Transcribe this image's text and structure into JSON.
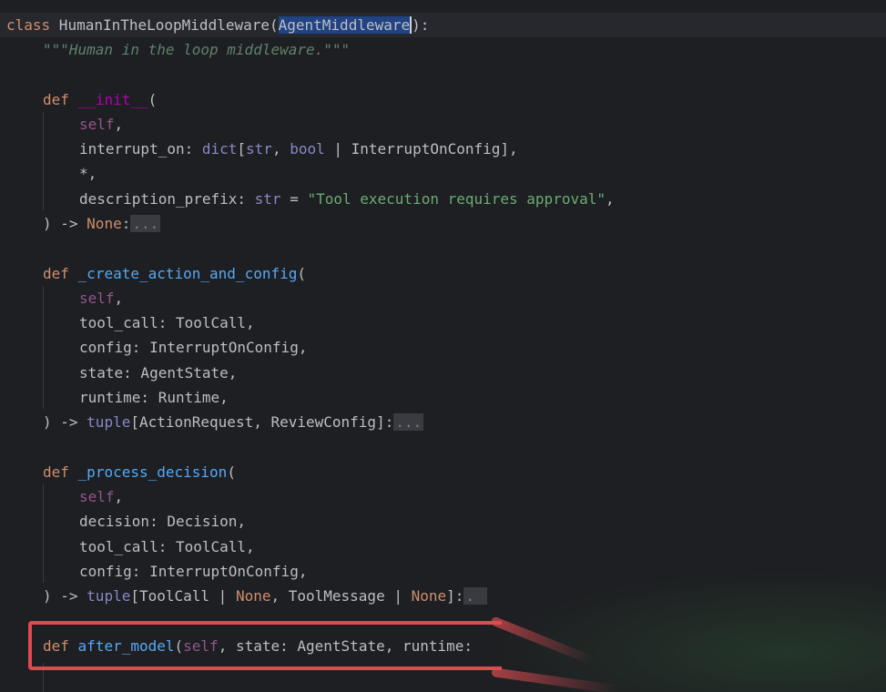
{
  "colors": {
    "background": "#1e1f22",
    "keyword": "#cf8e6d",
    "function_name": "#56a8f5",
    "self": "#94558d",
    "builtin": "#8888c6",
    "string": "#6aab73",
    "docstring": "#5f826b",
    "selection": "#214283",
    "annotation_box": "#e0494f"
  },
  "code": {
    "class_line": {
      "kw": "class",
      "name": " HumanInTheLoopMiddleware(",
      "base": "AgentMiddleware",
      "end": "):"
    },
    "docstring": "\"\"\"Human in the loop middleware.\"\"\"",
    "init": {
      "kw": "def",
      "name": "__init__",
      "open": "(",
      "self": "self",
      "comma": ",",
      "p1_name": "interrupt_on: ",
      "p1_dict": "dict",
      "p1_b1": "[",
      "p1_str": "str",
      "p1_sep": ", ",
      "p1_bool": "bool",
      "p1_rest": " | InterruptOnConfig],",
      "star": "*,",
      "p2_name": "description_prefix: ",
      "p2_str": "str",
      "p2_eq": " = ",
      "p2_val": "\"Tool execution requires approval\"",
      "p2_end": ",",
      "ret_arrow": ") -> ",
      "ret_type": "None",
      "ret_colon": ":",
      "fold": "..."
    },
    "create": {
      "kw": "def",
      "name": "_create_action_and_config",
      "open": "(",
      "self": "self",
      "comma": ",",
      "p1": "tool_call: ToolCall,",
      "p2": "config: InterruptOnConfig,",
      "p3": "state: AgentState,",
      "p4": "runtime: Runtime,",
      "ret_arrow": ") -> ",
      "ret_tuple": "tuple",
      "ret_rest": "[ActionRequest, ReviewConfig]:",
      "fold": "..."
    },
    "process": {
      "kw": "def",
      "name": "_process_decision",
      "open": "(",
      "self": "self",
      "comma": ",",
      "p1": "decision: Decision,",
      "p2": "tool_call: ToolCall,",
      "p3": "config: InterruptOnConfig,",
      "ret_arrow": ") -> ",
      "ret_tuple": "tuple",
      "ret_a": "[ToolCall | ",
      "ret_none1": "None",
      "ret_b": ", ToolMessage | ",
      "ret_none2": "None",
      "ret_c": "]:",
      "fold": "."
    },
    "after_model": {
      "kw": "def",
      "name": "after_model",
      "open": "(",
      "self": "self",
      "rest": ", state: AgentState, runtime:"
    }
  }
}
